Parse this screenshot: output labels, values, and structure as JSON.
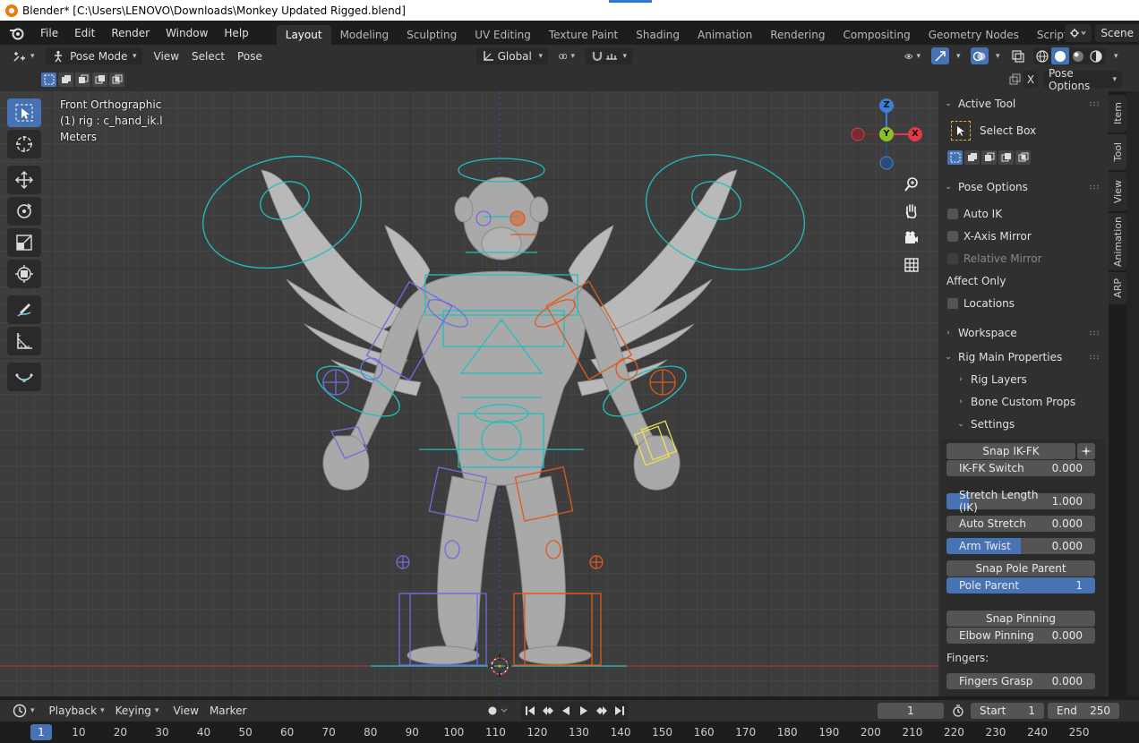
{
  "window": {
    "title": "Blender* [C:\\Users\\LENOVO\\Downloads\\Monkey Updated Rigged.blend]"
  },
  "menu": {
    "items": [
      "File",
      "Edit",
      "Render",
      "Window",
      "Help"
    ]
  },
  "workspaces": {
    "tabs": [
      "Layout",
      "Modeling",
      "Sculpting",
      "UV Editing",
      "Texture Paint",
      "Shading",
      "Animation",
      "Rendering",
      "Compositing",
      "Geometry Nodes",
      "Scripting"
    ],
    "active": "Layout",
    "plus": "+",
    "scene": "Scene"
  },
  "viewport_header": {
    "mode": "Pose Mode",
    "view": "View",
    "select": "Select",
    "pose": "Pose",
    "orientation": "Global",
    "x_label": "X",
    "options": "Pose Options"
  },
  "viewport": {
    "view_name": "Front Orthographic",
    "object_info": "(1) rig : c_hand_ik.l",
    "units": "Meters",
    "gizmo": {
      "x": "X",
      "y": "Y",
      "z": "Z"
    }
  },
  "npanel": {
    "active_tool_header": "Active Tool",
    "select_box": "Select Box",
    "pose_options_header": "Pose Options",
    "auto_ik": "Auto IK",
    "x_axis_mirror": "X-Axis Mirror",
    "relative_mirror": "Relative Mirror",
    "affect_only": "Affect Only",
    "locations": "Locations",
    "workspace_header": "Workspace",
    "rig_main_header": "Rig Main Properties",
    "rig_layers": "Rig Layers",
    "bone_custom_props": "Bone Custom Props",
    "settings": "Settings",
    "snap_ik_fk": "Snap IK-FK",
    "ik_fk_switch": {
      "label": "IK-FK Switch",
      "value": "0.000"
    },
    "stretch_length": {
      "label": "Stretch Length (IK)",
      "value": "1.000",
      "fill": 0.15
    },
    "auto_stretch": {
      "label": "Auto Stretch",
      "value": "0.000"
    },
    "arm_twist": {
      "label": "Arm Twist",
      "value": "0.000",
      "fill": 0.5
    },
    "snap_pole_parent": "Snap Pole Parent",
    "pole_parent": {
      "label": "Pole Parent",
      "value": "1"
    },
    "snap_pinning": "Snap Pinning",
    "elbow_pinning": {
      "label": "Elbow Pinning",
      "value": "0.000"
    },
    "fingers_label": "Fingers:",
    "fingers_grasp": {
      "label": "Fingers Grasp",
      "value": "0.000"
    }
  },
  "vtabs": [
    "Item",
    "Tool",
    "View",
    "Animation",
    "ARP"
  ],
  "timeline": {
    "playback": "Playback",
    "keying": "Keying",
    "view": "View",
    "marker": "Marker",
    "current_frame": "1",
    "start_label": "Start",
    "start_value": "1",
    "end_label": "End",
    "end_value": "250"
  },
  "ruler": {
    "current": "1",
    "frames": [
      "10",
      "20",
      "30",
      "40",
      "50",
      "60",
      "70",
      "80",
      "90",
      "100",
      "110",
      "120",
      "130",
      "140",
      "150",
      "160",
      "170",
      "180",
      "190",
      "200",
      "210",
      "220",
      "230",
      "240",
      "250"
    ]
  },
  "colors": {
    "accent": "#4772b3",
    "rig_cyan": "#1fbfbf",
    "rig_blue": "#6e6ee0",
    "rig_orange": "#e0591a",
    "axis_x": "#e63946",
    "axis_y": "#8dbf26",
    "axis_z": "#3f7fd6"
  }
}
